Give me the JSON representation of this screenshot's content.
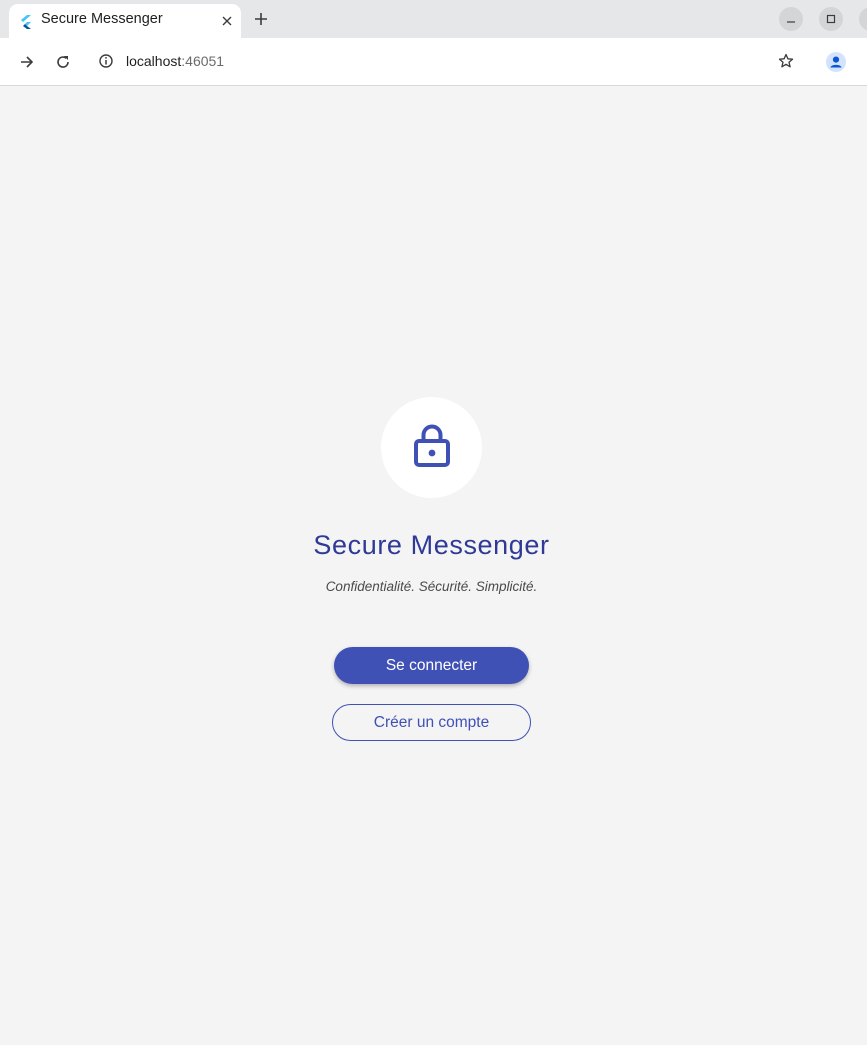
{
  "browser": {
    "tab": {
      "title": "Secure Messenger",
      "favicon": "flutter-icon"
    },
    "new_tab_icon": "plus-icon",
    "window_controls": [
      "minimize-icon",
      "maximize-icon",
      "close-icon"
    ],
    "address_bar": {
      "host": "localhost",
      "port": ":46051"
    }
  },
  "app": {
    "logo_icon": "lock-icon",
    "title": "Secure Messenger",
    "tagline": "Confidentialité. Sécurité. Simplicité.",
    "login_label": "Se connecter",
    "signup_label": "Créer un compte"
  },
  "colors": {
    "primary": "#3f51b5",
    "title": "#2e3a96",
    "background": "#f4f4f4"
  }
}
